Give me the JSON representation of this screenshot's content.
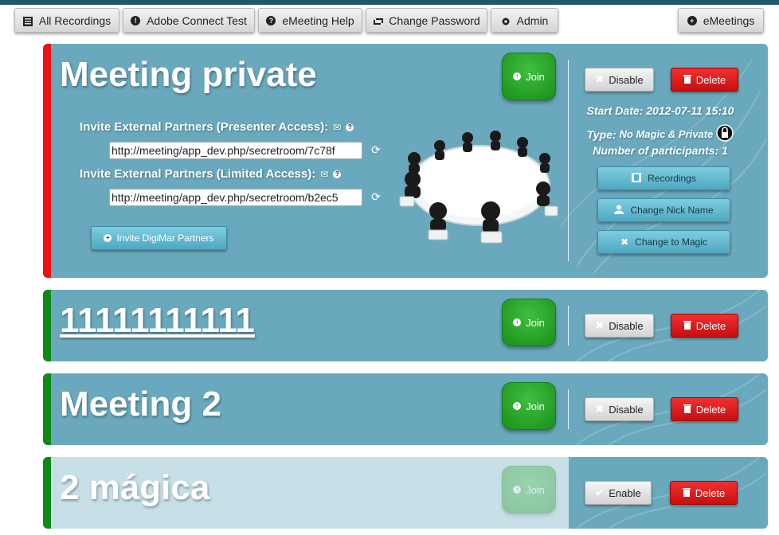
{
  "nav": {
    "all_recordings": "All Recordings",
    "adobe_connect_test": "Adobe Connect Test",
    "emeeting_help": "eMeeting Help",
    "change_password": "Change Password",
    "admin": "Admin",
    "emeetings": "eMeetings"
  },
  "meetings": [
    {
      "title": "Meeting private",
      "status_color": "#ee1111",
      "join_label": "Join",
      "toggle_label": "Disable",
      "delete_label": "Delete",
      "invite_presenter_label": "Invite External Partners (Presenter Access):",
      "invite_presenter_url": "http://meeting/app_dev.php/secretroom/7c78f",
      "invite_limited_label": "Invite External Partners (Limited Access):",
      "invite_limited_url": "http://meeting/app_dev.php/secretroom/b2ec5",
      "invite_digimar_label": "Invite DigiMar Partners",
      "start_date": "Start Date: 2012-07-11 15:10",
      "type_label": "Type:",
      "type_value": "No Magic & Private",
      "participants": "Number of participants: 1",
      "recordings_label": "Recordings",
      "change_nick_label": "Change Nick Name",
      "change_magic_label": "Change to Magic"
    },
    {
      "title": "11111111111",
      "status_color": "#0e8a1a",
      "join_label": "Join",
      "toggle_label": "Disable",
      "delete_label": "Delete"
    },
    {
      "title": "Meeting 2",
      "status_color": "#0e8a1a",
      "join_label": "Join",
      "toggle_label": "Disable",
      "delete_label": "Delete"
    },
    {
      "title": "2 mágica",
      "status_color": "#0e8a1a",
      "join_label": "Join",
      "toggle_label": "Enable",
      "delete_label": "Delete"
    }
  ]
}
